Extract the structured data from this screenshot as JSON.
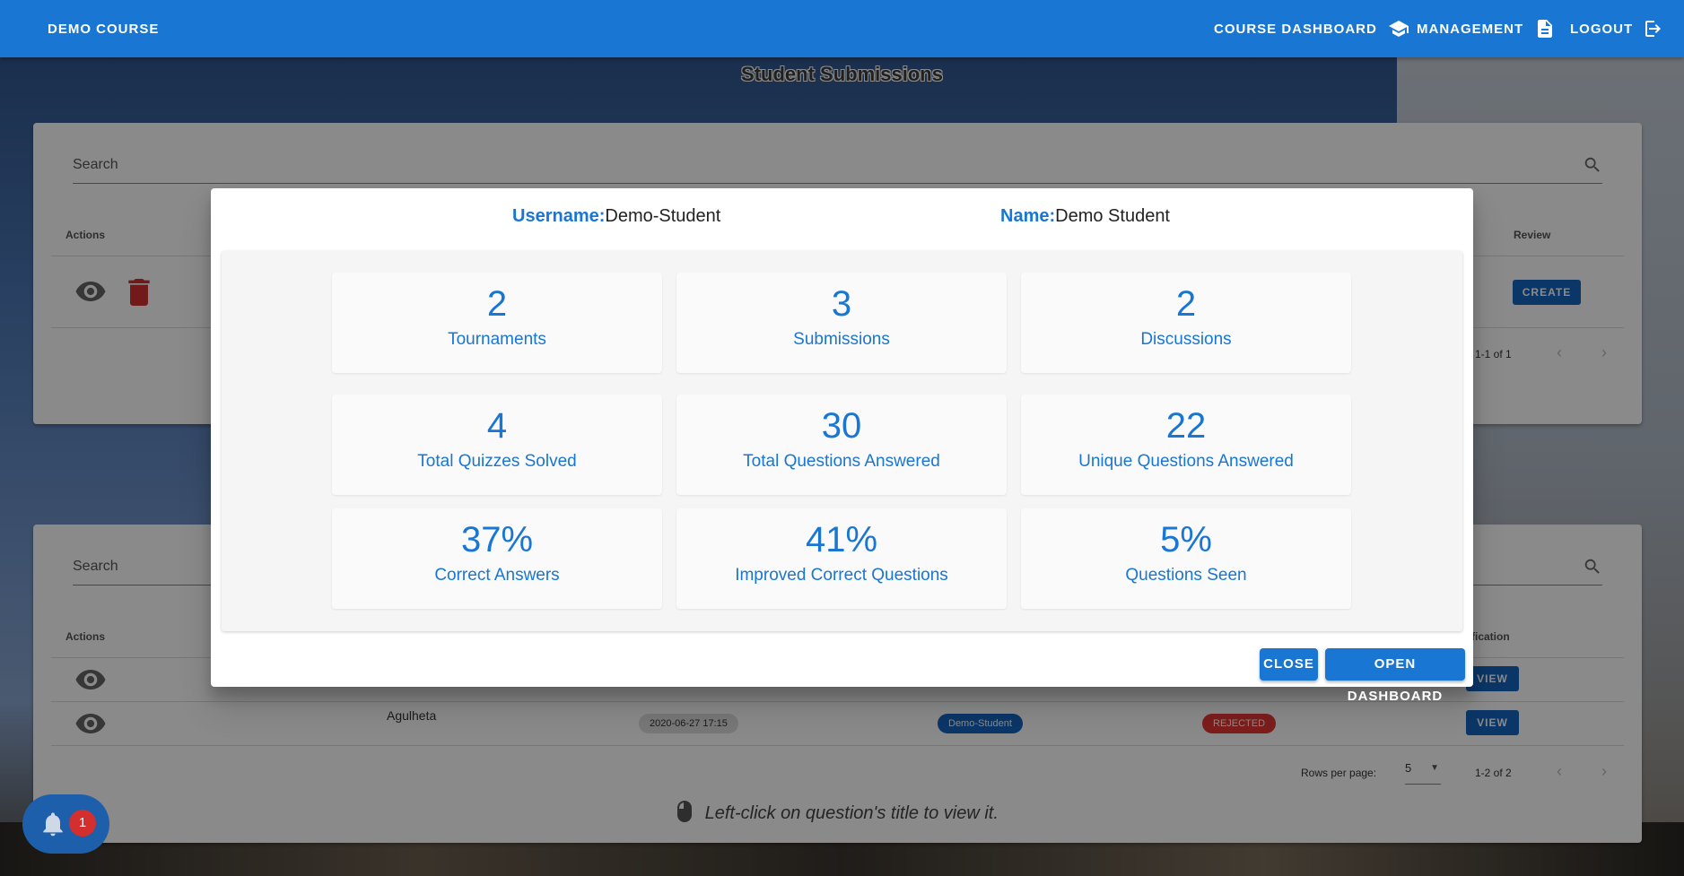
{
  "topbar": {
    "brand": "DEMO COURSE",
    "course_dashboard": "COURSE DASHBOARD",
    "management": "MANAGEMENT",
    "logout": "LOGOUT"
  },
  "page_title": "Student Submissions",
  "card1": {
    "search_placeholder": "Search",
    "col_actions": "Actions",
    "col_review": "Review",
    "create_button": "CREATE",
    "pagination": "1-1 of 1"
  },
  "card2": {
    "search_placeholder": "Search",
    "col_actions": "Actions",
    "col_notification_partial": "fication",
    "rows": [
      {
        "view": "VIEW"
      },
      {
        "title": "Agulheta",
        "date": "2020-06-27 17:15",
        "student": "Demo-Student",
        "status": "REJECTED",
        "view": "VIEW"
      }
    ],
    "rows_per_page_label": "Rows per page:",
    "rows_per_page_value": "5",
    "pagination": "1-2 of 2",
    "hint": "Left-click on question's title to view it."
  },
  "dialog": {
    "username_label": "Username:",
    "username_value": "Demo-Student",
    "name_label": "Name:",
    "name_value": "Demo Student",
    "stats": [
      {
        "value": "2",
        "label": "Tournaments"
      },
      {
        "value": "3",
        "label": "Submissions"
      },
      {
        "value": "2",
        "label": "Discussions"
      },
      {
        "value": "4",
        "label": "Total Quizzes Solved"
      },
      {
        "value": "30",
        "label": "Total Questions Answered"
      },
      {
        "value": "22",
        "label": "Unique Questions Answered"
      },
      {
        "value": "37%",
        "label": "Correct Answers"
      },
      {
        "value": "41%",
        "label": "Improved Correct Questions"
      },
      {
        "value": "5%",
        "label": "Questions Seen"
      }
    ],
    "close_button": "CLOSE",
    "open_dashboard_button": "OPEN DASHBOARD"
  },
  "notifications": {
    "count": "1"
  },
  "colors": {
    "primary": "#1976d2",
    "danger": "#d32f2f"
  }
}
